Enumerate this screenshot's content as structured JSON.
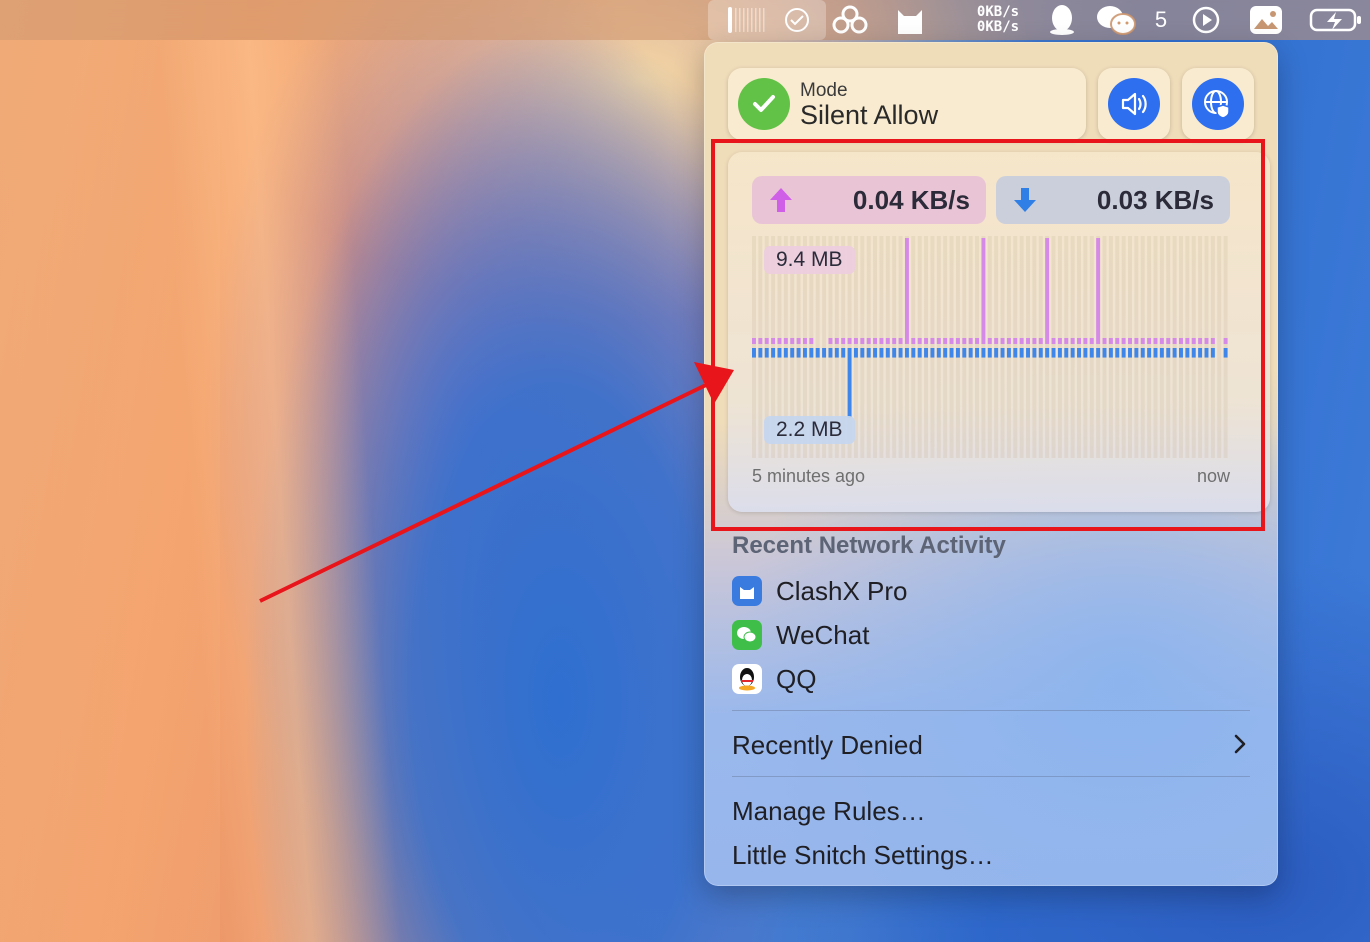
{
  "menubar": {
    "upload_speed": "0KB/s",
    "download_speed": "0KB/s",
    "badge_count": "5",
    "icons": [
      "little-snitch-icon",
      "check-circle-icon",
      "clouds-icon",
      "cat-icon",
      "qq-penguin-icon",
      "wechat-icon",
      "play-icon",
      "photo-icon",
      "battery-charging-icon"
    ]
  },
  "mode": {
    "label": "Mode",
    "value": "Silent Allow",
    "status_color": "#62c247"
  },
  "traffic": {
    "upload_rate": "0.04 KB/s",
    "download_rate": "0.03 KB/s",
    "peak_upload": "9.4 MB",
    "peak_download": "2.2 MB",
    "time_start": "5 minutes ago",
    "time_end": "now",
    "upload_color": "#d68ae8",
    "download_color": "#3f86ea"
  },
  "chart_data": {
    "type": "bar",
    "x_start": "5 minutes ago",
    "x_end": "now",
    "series": [
      {
        "name": "upload",
        "values": [
          0.3,
          0.3,
          0.3,
          0.3,
          0.3,
          0.3,
          0.3,
          0.3,
          0.3,
          0.3,
          0,
          0,
          0.3,
          0.3,
          0.3,
          0.3,
          0.3,
          0.3,
          0.3,
          0.3,
          0.3,
          0.3,
          0.3,
          0.3,
          9.4,
          0.3,
          0.3,
          0.3,
          0.3,
          0.3,
          0.3,
          0.3,
          0.3,
          0.3,
          0.3,
          0.3,
          9.4,
          0.3,
          0.3,
          0.3,
          0.3,
          0.3,
          0.3,
          0.3,
          0.3,
          0.3,
          9.4,
          0.3,
          0.3,
          0.3,
          0.3,
          0.3,
          0.3,
          0.3,
          9.4,
          0.3,
          0.3,
          0.3,
          0.3,
          0.3,
          0.3,
          0.3,
          0.3,
          0.3,
          0.3,
          0.3,
          0.3,
          0.3,
          0.3,
          0.3,
          0.3,
          0.3,
          0.3,
          0,
          0.3
        ]
      },
      {
        "name": "download",
        "values": [
          0.3,
          0.3,
          0.3,
          0.3,
          0.3,
          0.3,
          0.3,
          0.3,
          0.3,
          0.3,
          0.3,
          0.3,
          0.3,
          0.3,
          0.3,
          2.2,
          0.3,
          0.3,
          0.3,
          0.3,
          0.3,
          0.3,
          0.3,
          0.3,
          0.3,
          0.3,
          0.3,
          0.3,
          0.3,
          0.3,
          0.3,
          0.3,
          0.3,
          0.3,
          0.3,
          0.3,
          0.3,
          0.3,
          0.3,
          0.3,
          0.3,
          0.3,
          0.3,
          0.3,
          0.3,
          0.3,
          0.3,
          0.3,
          0.3,
          0.3,
          0.3,
          0.3,
          0.3,
          0.3,
          0.3,
          0.3,
          0.3,
          0.3,
          0.3,
          0.3,
          0.3,
          0.3,
          0.3,
          0.3,
          0.3,
          0.3,
          0.3,
          0.3,
          0.3,
          0.3,
          0.3,
          0.3,
          0.3,
          0,
          0.3
        ]
      }
    ],
    "peak_up_mb": 9.4,
    "peak_down_mb": 2.2
  },
  "recent": {
    "title": "Recent Network Activity",
    "apps": [
      {
        "name": "ClashX Pro",
        "icon": "clashx-cat-icon",
        "color": "#3a7be0"
      },
      {
        "name": "WeChat",
        "icon": "wechat-icon",
        "color": "#3fbf4a"
      },
      {
        "name": "QQ",
        "icon": "qq-penguin-icon",
        "color": "#ffffff"
      }
    ]
  },
  "menu": {
    "recently_denied": "Recently Denied",
    "manage_rules": "Manage Rules…",
    "settings": "Little Snitch Settings…"
  },
  "annotation": {
    "highlight_color": "#e8151b"
  }
}
